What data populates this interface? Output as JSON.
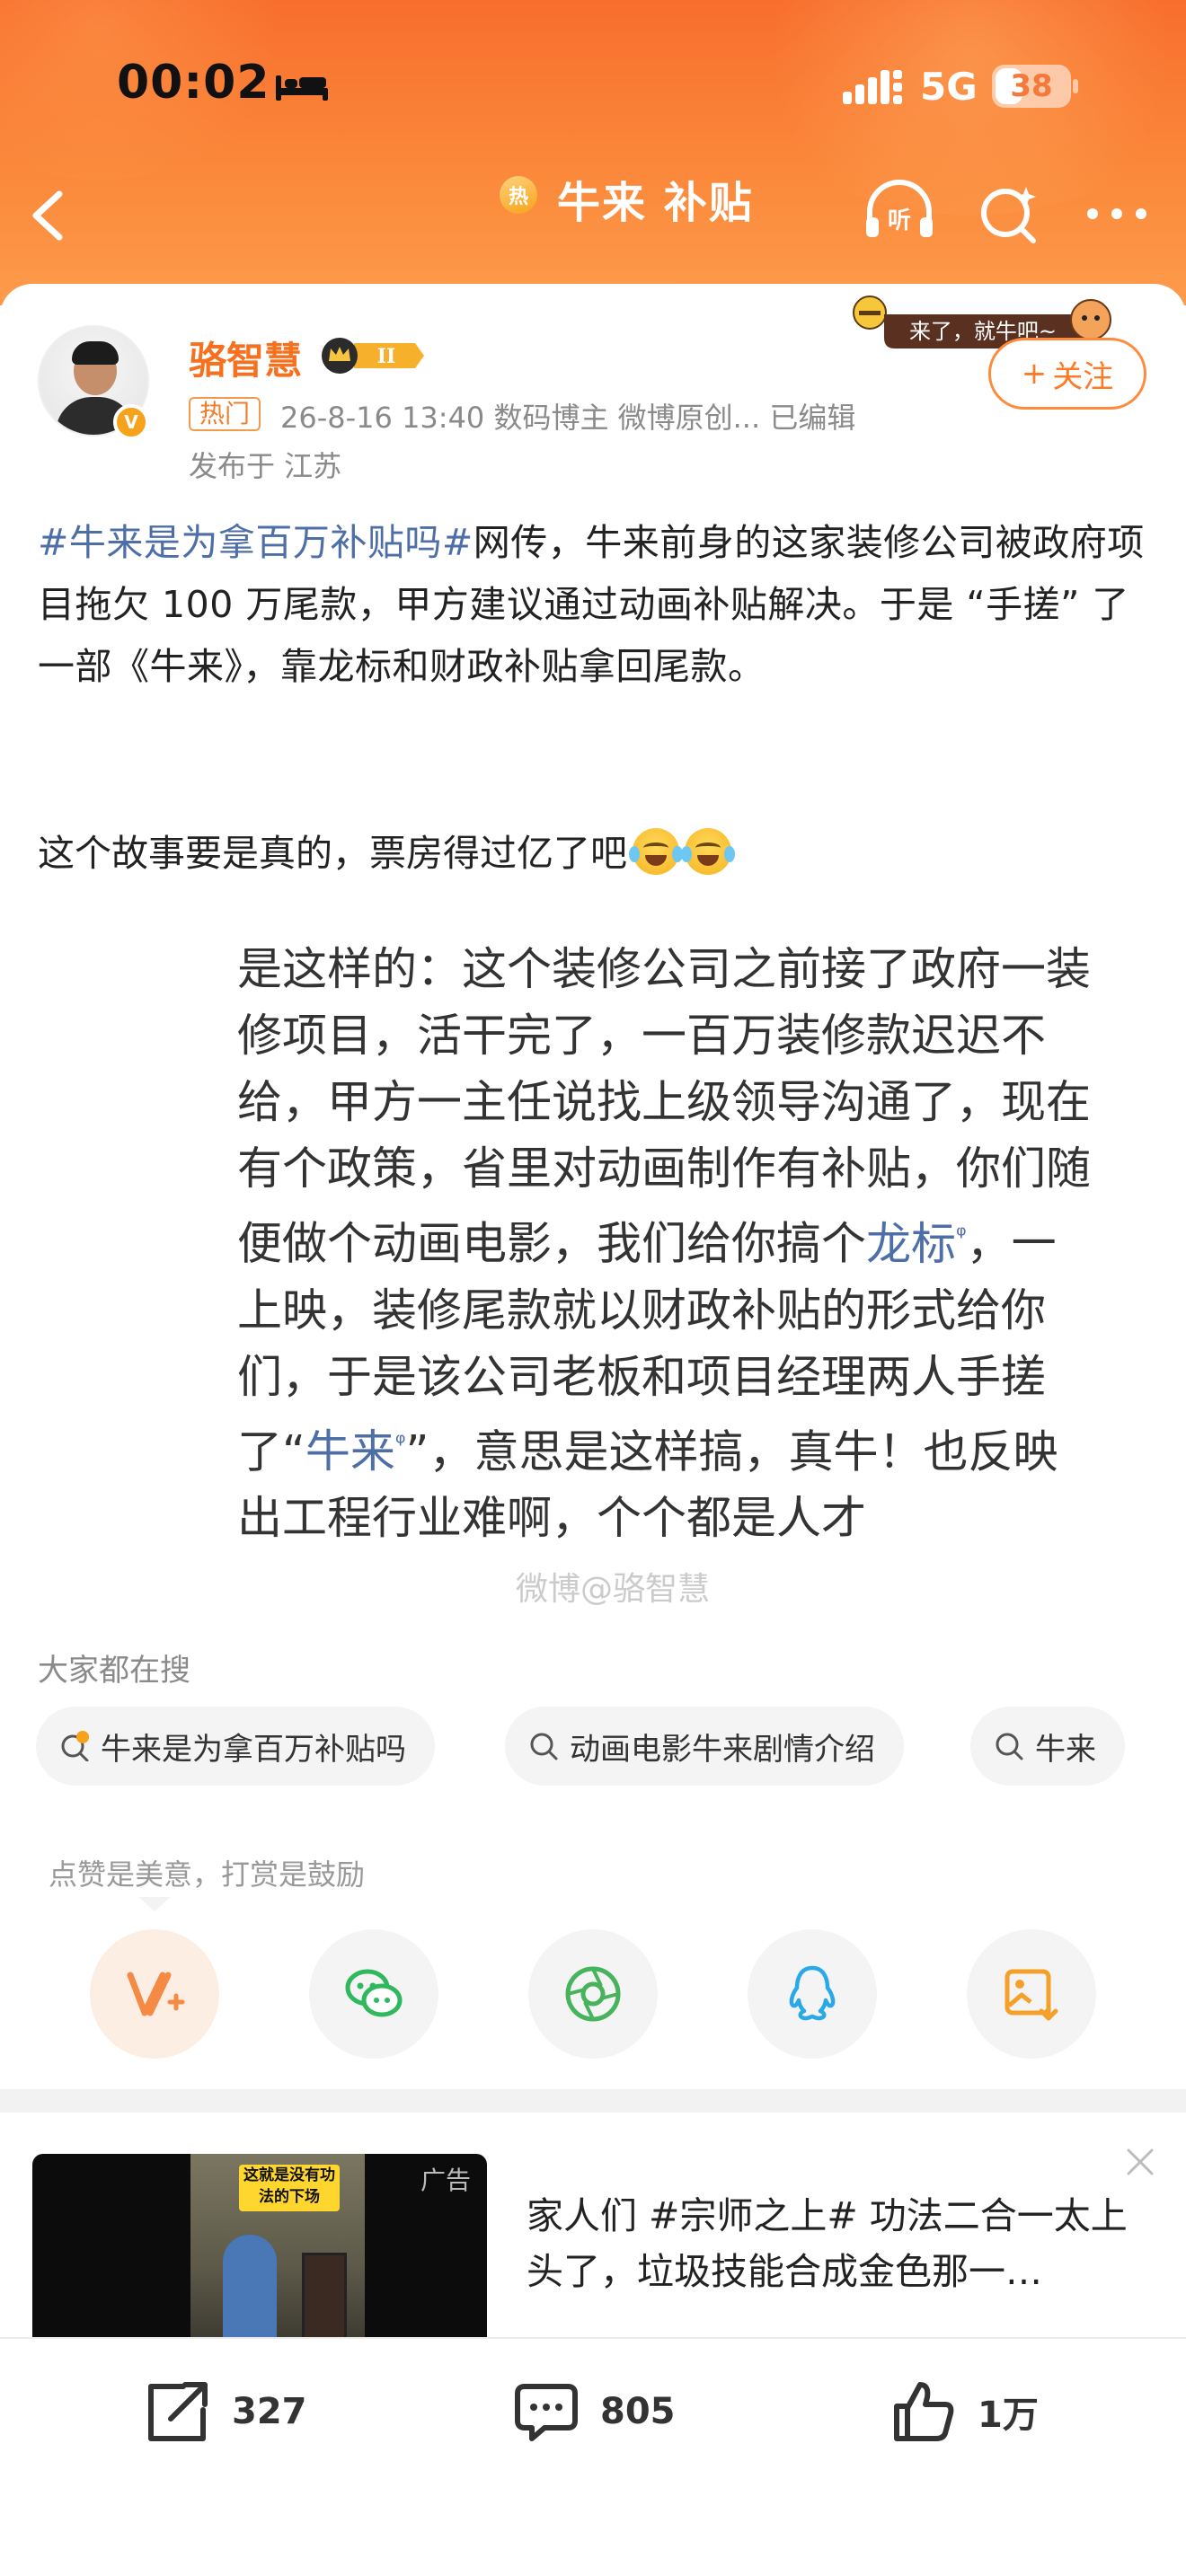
{
  "status_bar": {
    "time": "00:02",
    "network": "5G",
    "battery": "38",
    "battery_level": 0.38
  },
  "header": {
    "topic_badge": "热",
    "title": "牛来 补贴",
    "listen_label": "听"
  },
  "author": {
    "name": "骆智慧",
    "vip_level": "II",
    "hot_tag": "热门",
    "meta": "26-8-16 13:40   数码博主 微博原创...   已编辑",
    "location": "发布于 江苏",
    "follow_label": "关注",
    "follow_plus": "+",
    "sticker_text": "来了，就牛吧~"
  },
  "post": {
    "hashtag": "#牛来是为拿百万补贴吗#",
    "body": "网传，牛来前身的这家装修公司被政府项目拖欠 100 万尾款，甲方建议通过动画补贴解决。于是 “手搓” 了一部《牛来》，靠龙标和财政补贴拿回尾款。",
    "line2": "这个故事要是真的，票房得过亿了吧"
  },
  "embedded_image": {
    "part1": "是这样的：这个装修公司之前接了政府一装修项目，活干完了，一百万装修款迟迟不给，甲方一主任说找上级领导沟通了，现在有个政策，省里对动画制作有补贴，你们随便做个动画电影，我们给你搞个",
    "link1": "龙标",
    "part2": "，一上映，装修尾款就以财政补贴的形式给你们，于是该公司老板和项目经理两人手搓了“",
    "link2": "牛来",
    "part3": "”，意思是这样搞，真牛！也反映出工程行业难啊，个个都是人才",
    "link_mark": "ᵠ",
    "watermark": "微博@骆智慧"
  },
  "search": {
    "title": "大家都在搜",
    "chips": [
      {
        "label": "牛来是为拿百万补贴吗",
        "icon": "hot-search-icon"
      },
      {
        "label": "动画电影牛来剧情介绍",
        "icon": "search-icon"
      },
      {
        "label": "牛来",
        "icon": "search-icon"
      }
    ]
  },
  "tipping": {
    "label": "点赞是美意，打赏是鼓励",
    "share_targets": [
      "weibo-v-plus-icon",
      "wechat-icon",
      "moments-icon",
      "qq-icon",
      "save-image-icon"
    ]
  },
  "ad": {
    "tag": "广告",
    "thumb_caption": "这就是没有功法的下场",
    "text": "家人们 #宗师之上# 功法二合一太上头了，垃圾技能合成金色那一…"
  },
  "actions": {
    "share_count": "327",
    "comment_count": "805",
    "like_count": "1万"
  },
  "colors": {
    "header_orange": "#f86e2d",
    "username_orange": "#f5711f",
    "link_blue": "#4e6ea8"
  }
}
